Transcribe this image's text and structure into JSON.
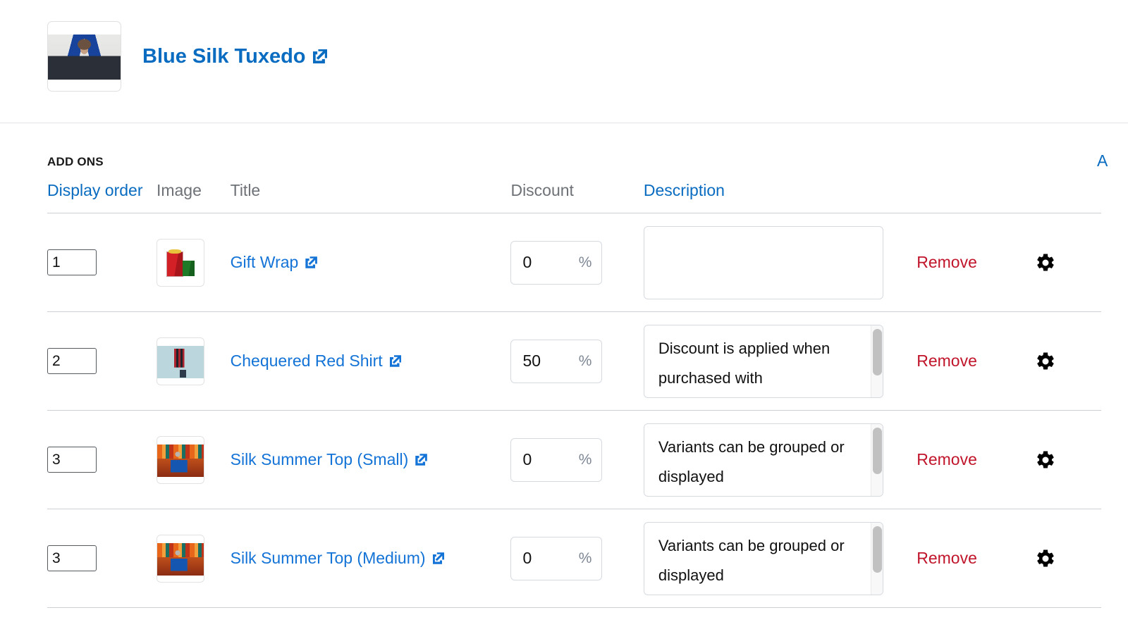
{
  "product": {
    "title": "Blue Silk Tuxedo",
    "thumb_alt": "blue-silk-tuxedo-thumbnail",
    "link_icon": "external-link-icon"
  },
  "addons": {
    "section_label": "ADD ONS",
    "action_label": "A",
    "columns": {
      "order": "Display order",
      "image": "Image",
      "title": "Title",
      "discount": "Discount",
      "description": "Description"
    },
    "percent_symbol": "%",
    "remove_label": "Remove",
    "settings_icon": "gear-icon",
    "rows": [
      {
        "order": "1",
        "image": "gift",
        "image_alt": "gift-wrap-thumbnail",
        "title": "Gift Wrap",
        "discount": "0",
        "description": "",
        "has_scrollbar": false
      },
      {
        "order": "2",
        "image": "shirt",
        "image_alt": "chequered-red-shirt-thumbnail",
        "title": "Chequered Red Shirt",
        "discount": "50",
        "description": "Discount is applied when purchased with",
        "has_scrollbar": true
      },
      {
        "order": "3",
        "image": "carnival",
        "image_alt": "silk-summer-top-small-thumbnail",
        "title": "Silk Summer Top (Small)",
        "discount": "0",
        "description": "Variants can be grouped or displayed",
        "has_scrollbar": true
      },
      {
        "order": "3",
        "image": "carnival",
        "image_alt": "silk-summer-top-medium-thumbnail",
        "title": "Silk Summer Top (Medium)",
        "discount": "0",
        "description": "Variants can be grouped or displayed",
        "has_scrollbar": true
      }
    ]
  },
  "colors": {
    "link_blue": "#1473d6",
    "title_blue": "#0a6cc0",
    "remove_red": "#c0152a",
    "header_gray": "#6e7277",
    "border_gray": "#ccd0d4"
  }
}
